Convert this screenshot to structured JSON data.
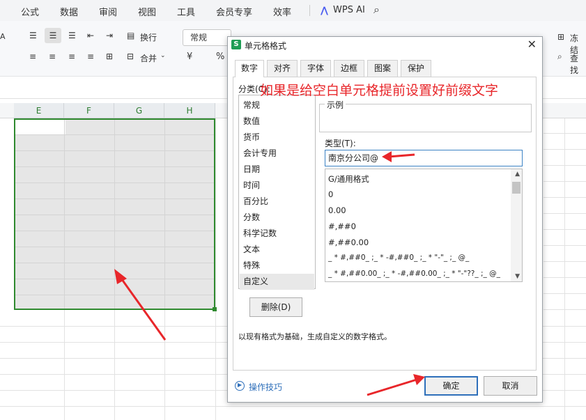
{
  "menubar": {
    "items": [
      "公式",
      "数据",
      "审阅",
      "视图",
      "工具",
      "会员专享",
      "效率"
    ],
    "wps_ai": "WPS AI"
  },
  "ribbon": {
    "wrap_label": "换行",
    "merge_label": "合并",
    "number_format": "常规",
    "freeze_label": "冻结",
    "find_label": "查找",
    "currency_symbol": "¥",
    "percent_symbol": "%"
  },
  "columns": [
    "E",
    "F",
    "G",
    "H"
  ],
  "dialog": {
    "title": "单元格格式",
    "tabs": [
      "数字",
      "对齐",
      "字体",
      "边框",
      "图案",
      "保护"
    ],
    "active_tab": "数字",
    "annotation": "如果是给空白单元格提前设置好前缀文字",
    "category_label": "分类(C):",
    "categories": [
      "常规",
      "数值",
      "货币",
      "会计专用",
      "日期",
      "时间",
      "百分比",
      "分数",
      "科学记数",
      "文本",
      "特殊",
      "自定义"
    ],
    "selected_category": "自定义",
    "sample_label": "示例",
    "type_label": "类型(T):",
    "type_value": "南京分公司@",
    "formats": [
      "G/通用格式",
      "0",
      "0.00",
      "#,##0",
      "#,##0.00",
      "_ * #,##0_ ;_ * -#,##0_ ;_ * \"-\"_ ;_ @_",
      "_ * #,##0.00_ ;_ * -#,##0.00_ ;_ * \"-\"??_ ;_ @_"
    ],
    "delete_button": "删除(D)",
    "description": "以现有格式为基础，生成自定义的数字格式。",
    "tips_link": "操作技巧",
    "ok_button": "确定",
    "cancel_button": "取消"
  },
  "colors": {
    "selection_border": "#2f8a2f",
    "annotation_red": "#e8262a",
    "arrow_red": "#e8262a",
    "accent_blue": "#2e6fba"
  }
}
